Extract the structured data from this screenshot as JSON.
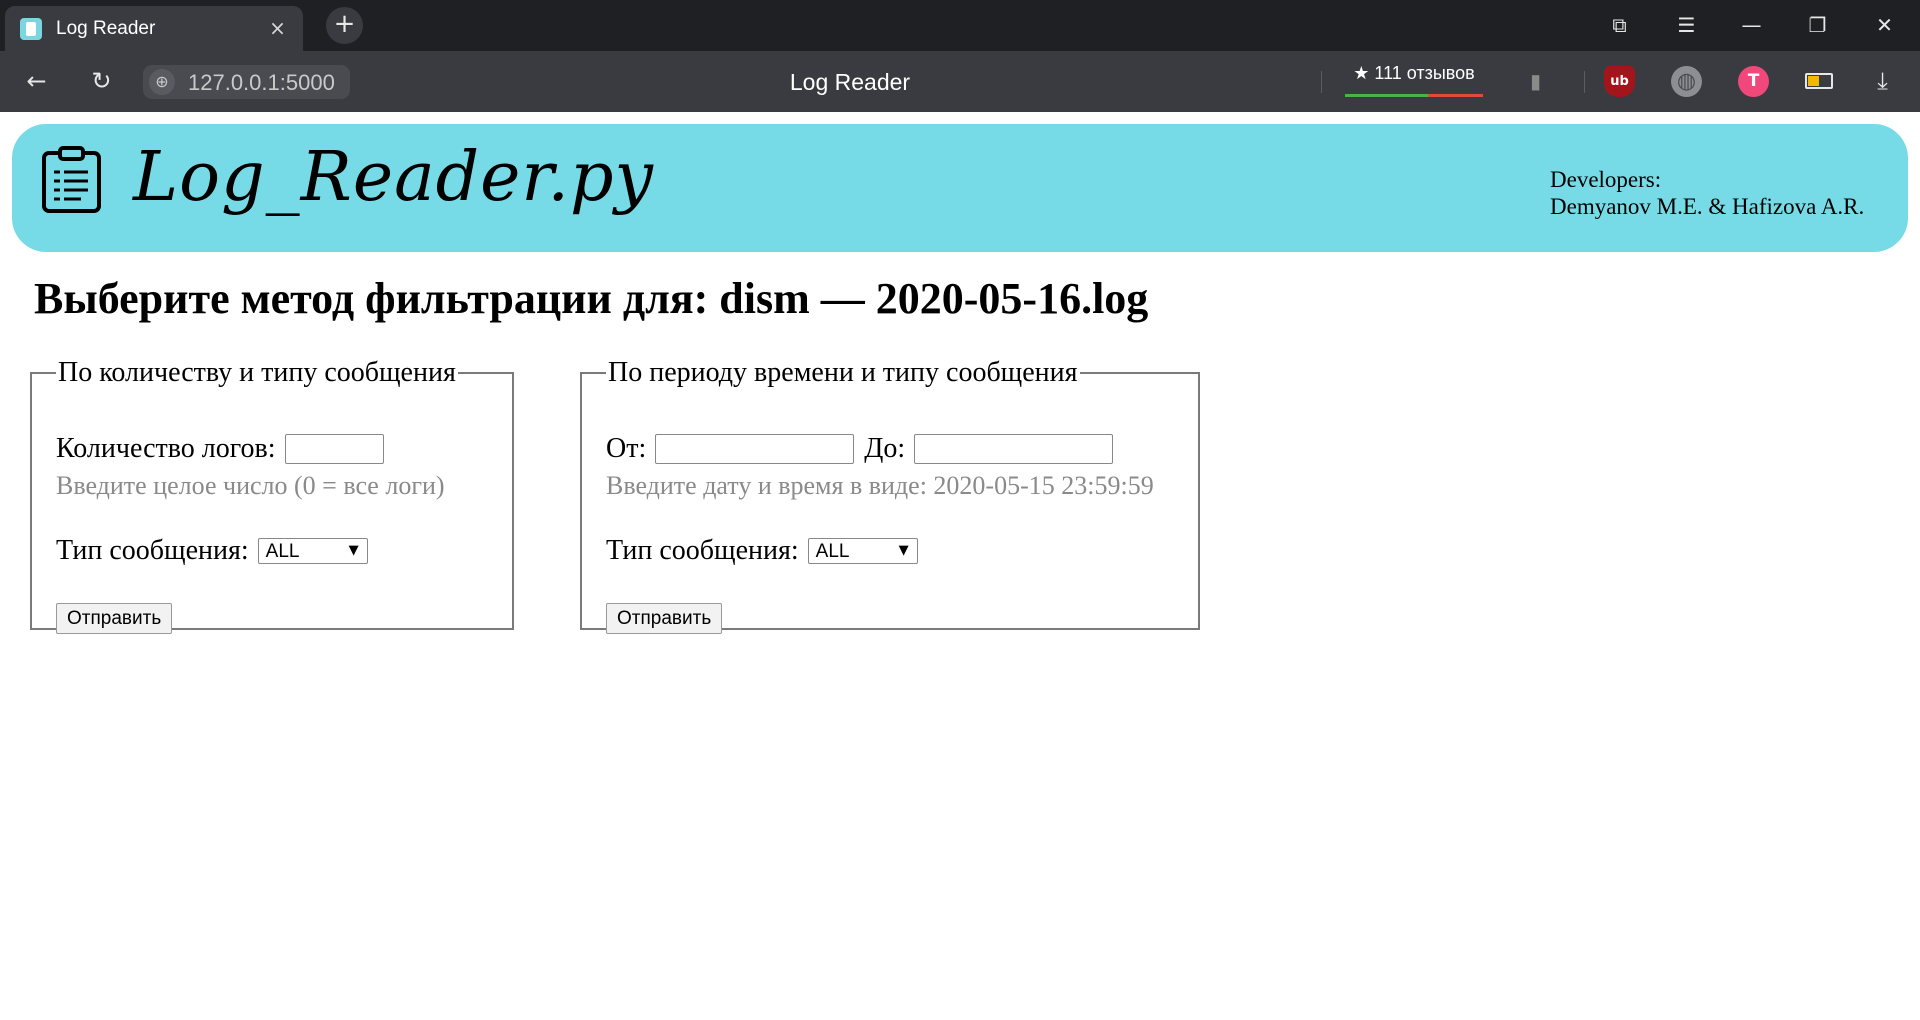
{
  "browser": {
    "tab_title": "Log Reader",
    "tab_close_icon": "×",
    "new_tab_icon": "+",
    "url": "127.0.0.1:5000",
    "page_title": "Log Reader",
    "reviews_label": "★ 111 отзывов",
    "window_icons": {
      "collections": "⧉",
      "menu": "☰",
      "minimize": "—",
      "restore": "❐",
      "close": "✕"
    },
    "nav_icons": {
      "back": "←",
      "reload": "↻"
    },
    "ext_icons": {
      "bookmark": "🔖",
      "ublock": "ub",
      "vpn": "◍",
      "translate": "T",
      "battery": "▭",
      "download": "⤓"
    }
  },
  "header": {
    "logo_text": "Log_Reader.py",
    "developers_label": "Developers:",
    "developers_names": "Demyanov M.E. & Hafizova A.R."
  },
  "page": {
    "heading": "Выберите метод фильтрации для: dism — 2020-05-16.log"
  },
  "form_count": {
    "legend": "По количеству и типу сообщения",
    "count_label": "Количество логов:",
    "count_value": "",
    "count_hint": "Введите целое число (0 = все логи)",
    "type_label": "Тип сообщения:",
    "type_selected": "ALL",
    "submit_label": "Отправить"
  },
  "form_period": {
    "legend": "По периоду времени и типу сообщения",
    "from_label": "От:",
    "from_value": "",
    "to_label": "До:",
    "to_value": "",
    "date_hint": "Введите дату и время в виде: 2020-05-15 23:59:59",
    "type_label": "Тип сообщения:",
    "type_selected": "ALL",
    "submit_label": "Отправить"
  },
  "colors": {
    "header_bg": "#76dbe6",
    "chrome_dark": "#1f2023",
    "chrome_toolbar": "#3a3b40"
  }
}
